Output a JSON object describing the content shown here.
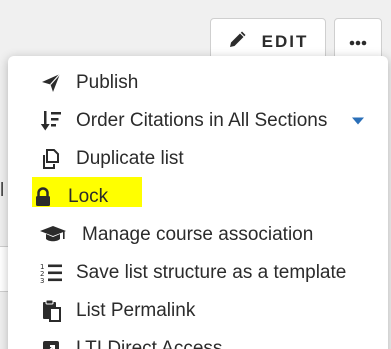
{
  "toolbar": {
    "edit_label": "EDIT"
  },
  "background": {
    "left_char": "l"
  },
  "menu": {
    "items": [
      {
        "label": "Publish",
        "icon": "paper-plane-icon"
      },
      {
        "label": "Order Citations in All Sections",
        "icon": "sort-icon"
      },
      {
        "label": "Duplicate list",
        "icon": "copy-icon"
      },
      {
        "label": "Lock",
        "icon": "lock-icon"
      },
      {
        "label": "Manage course association",
        "icon": "graduation-cap-icon"
      },
      {
        "label": "Save list structure as a template",
        "icon": "numbered-list-icon"
      },
      {
        "label": "List Permalink",
        "icon": "clipboard-icon"
      },
      {
        "label": "LTI Direct Access",
        "icon": "external-link-icon"
      }
    ]
  },
  "colors": {
    "highlight": "#ffff00",
    "caret": "#2a6fb8",
    "text": "#2b2b2b"
  }
}
